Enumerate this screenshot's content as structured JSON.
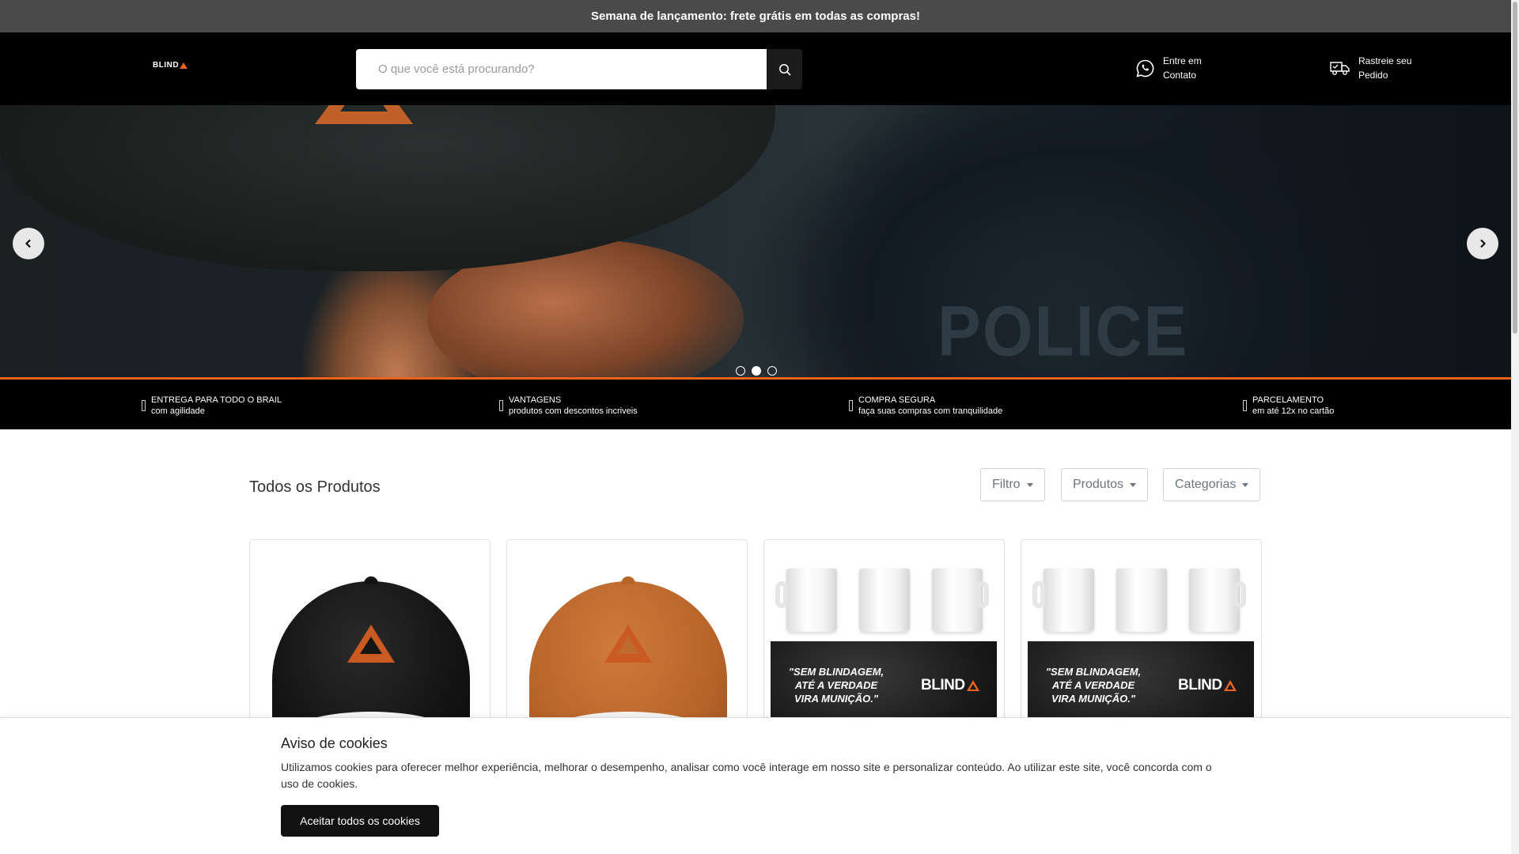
{
  "announcement": "Semana de lançamento: frete grátis em todas as compras!",
  "header": {
    "logo_text": "BLIND",
    "search_placeholder": "O que você está procurando?",
    "contact": {
      "line1": "Entre em",
      "line2": "Contato",
      "icon": "whatsapp-icon"
    },
    "tracking": {
      "line1": "Rastreie seu",
      "line2": "Pedido",
      "icon": "truck-icon"
    }
  },
  "hero": {
    "overlay_text": "POLICE",
    "slide_count": 3,
    "active_slide": 2
  },
  "benefits": [
    {
      "title": "ENTREGA PARA TODO O BRAIL",
      "subtitle": "com agilidade"
    },
    {
      "title": "VANTAGENS",
      "subtitle": "produtos com descontos incriveis"
    },
    {
      "title": "COMPRA SEGURA",
      "subtitle": "faça suas compras com tranquilidade"
    },
    {
      "title": "PARCELAMENTO",
      "subtitle": "em até 12x no cartão"
    }
  ],
  "products_section": {
    "title": "Todos os Produtos",
    "filters": [
      {
        "label": "Filtro"
      },
      {
        "label": "Produtos"
      },
      {
        "label": "Categorias"
      }
    ]
  },
  "product_cards": [
    {
      "type": "cap",
      "color": "#141414"
    },
    {
      "type": "cap",
      "color": "#c0682c"
    },
    {
      "type": "mug",
      "quote": "\"SEM BLINDAGEM, ATÉ A VERDADE VIRA MUNIÇÃO.\"",
      "brand": "BLIND"
    },
    {
      "type": "mug",
      "quote": "\"SEM BLINDAGEM, ATÉ A VERDADE VIRA MUNIÇÃO.\"",
      "brand": "BLIND"
    }
  ],
  "cookie": {
    "title": "Aviso de cookies",
    "text": "Utilizamos cookies para oferecer melhor experiência, melhorar o desempenho, analisar como você interage em nosso site e personalizar conteúdo. Ao utilizar este site, você concorda com o uso de cookies.",
    "button": "Aceitar todos os cookies"
  },
  "colors": {
    "accent": "#e8641e",
    "header_bg": "#000000",
    "announcement_bg": "#4a4a4a"
  }
}
